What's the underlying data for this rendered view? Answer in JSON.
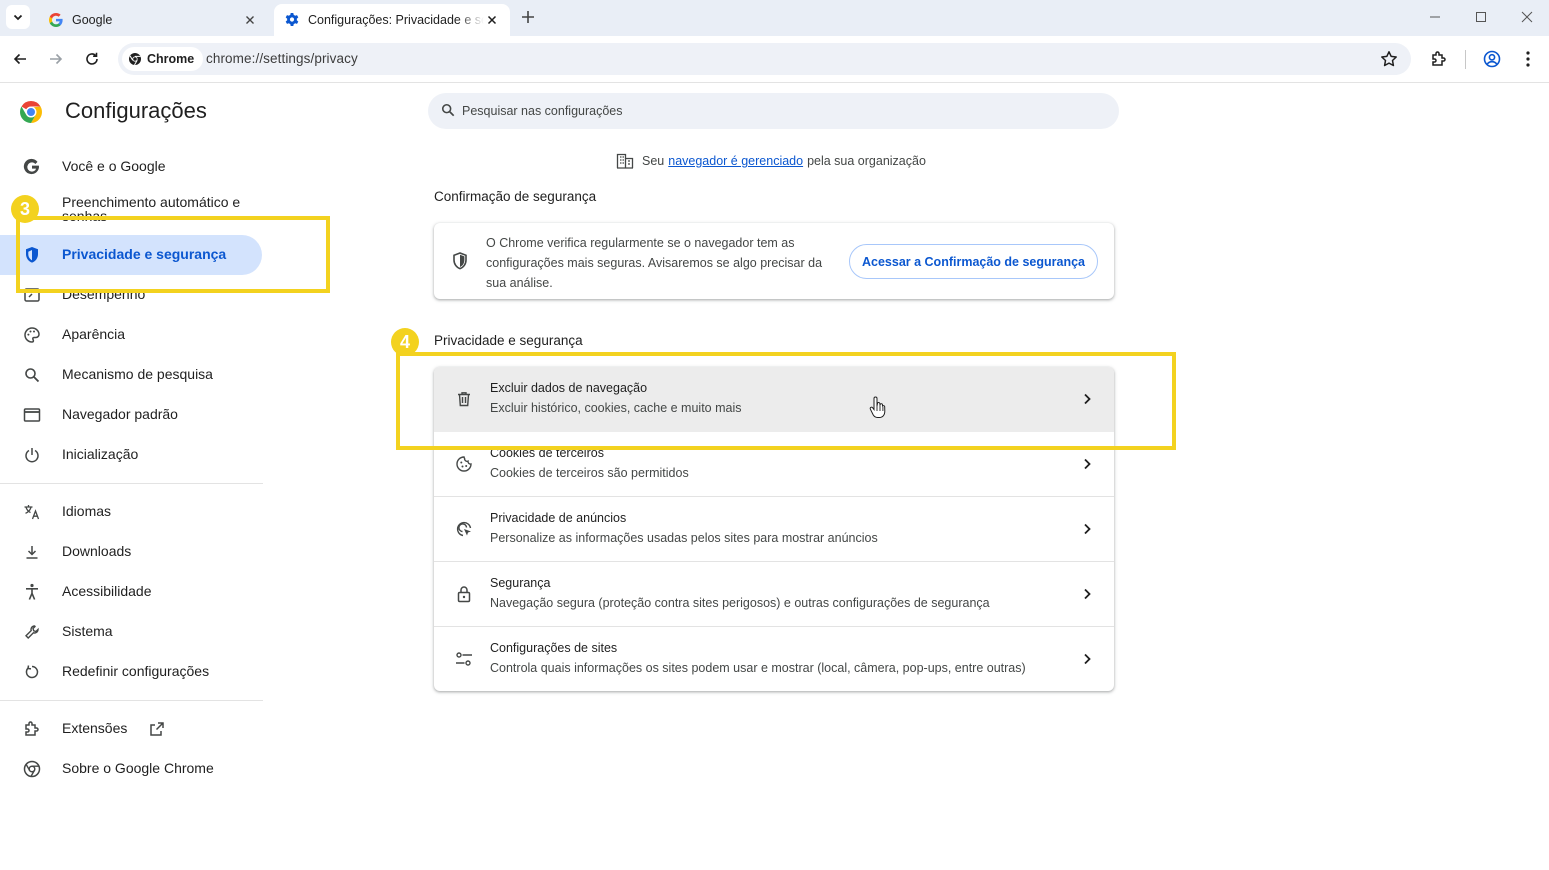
{
  "tabs": [
    {
      "title": "Google",
      "favicon": "google-g-icon",
      "active": false
    },
    {
      "title": "Configurações: Privacidade e segurança",
      "favicon": "gear-icon",
      "active": true
    }
  ],
  "omnibox": {
    "chip": "Chrome",
    "url": "chrome://settings/privacy"
  },
  "page": {
    "title": "Configurações"
  },
  "sidebar": {
    "items": [
      {
        "label": "Você e o Google",
        "icon": "google-g-icon"
      },
      {
        "label": "Preenchimento automático e senhas",
        "icon": "autofill-icon"
      },
      {
        "label": "Privacidade e segurança",
        "icon": "shield-icon",
        "active": true
      },
      {
        "label": "Desempenho",
        "icon": "speedometer-icon"
      },
      {
        "label": "Aparência",
        "icon": "palette-icon"
      },
      {
        "label": "Mecanismo de pesquisa",
        "icon": "search-icon"
      },
      {
        "label": "Navegador padrão",
        "icon": "browser-window-icon"
      },
      {
        "label": "Inicialização",
        "icon": "power-icon"
      },
      {
        "label": "Idiomas",
        "icon": "translate-icon"
      },
      {
        "label": "Downloads",
        "icon": "download-icon"
      },
      {
        "label": "Acessibilidade",
        "icon": "accessibility-icon"
      },
      {
        "label": "Sistema",
        "icon": "wrench-icon"
      },
      {
        "label": "Redefinir configurações",
        "icon": "reset-icon"
      },
      {
        "label": "Extensões",
        "icon": "puzzle-icon"
      },
      {
        "label": "Sobre o Google Chrome",
        "icon": "chrome-icon"
      }
    ]
  },
  "search": {
    "placeholder": "Pesquisar nas configurações"
  },
  "managed_notice": {
    "prefix": "Seu",
    "link": "navegador é gerenciado",
    "suffix": "pela sua organização"
  },
  "safety_check": {
    "heading": "Confirmação de segurança",
    "text": "O Chrome verifica regularmente se o navegador tem as configurações mais seguras. Avisaremos se algo precisar da sua análise.",
    "button": "Acessar a Confirmação de segurança"
  },
  "privacy": {
    "heading": "Privacidade e segurança",
    "rows": [
      {
        "title": "Excluir dados de navegação",
        "subtitle": "Excluir histórico, cookies, cache e muito mais",
        "icon": "trash-icon"
      },
      {
        "title": "Cookies de terceiros",
        "subtitle": "Cookies de terceiros são permitidos",
        "icon": "cookie-icon"
      },
      {
        "title": "Privacidade de anúncios",
        "subtitle": "Personalize as informações usadas pelos sites para mostrar anúncios",
        "icon": "ad-privacy-icon"
      },
      {
        "title": "Segurança",
        "subtitle": "Navegação segura (proteção contra sites perigosos) e outras configurações de segurança",
        "icon": "lock-icon"
      },
      {
        "title": "Configurações de sites",
        "subtitle": "Controla quais informações os sites podem usar e mostrar (local, câmera, pop-ups, entre outras)",
        "icon": "sliders-icon"
      }
    ]
  },
  "annotations": [
    {
      "number": "3"
    },
    {
      "number": "4"
    }
  ],
  "colors": {
    "accent": "#0b57d0",
    "active_nav_bg": "#d3e3fd",
    "highlight": "#f3d21f",
    "tabstrip": "#e9eef6"
  }
}
